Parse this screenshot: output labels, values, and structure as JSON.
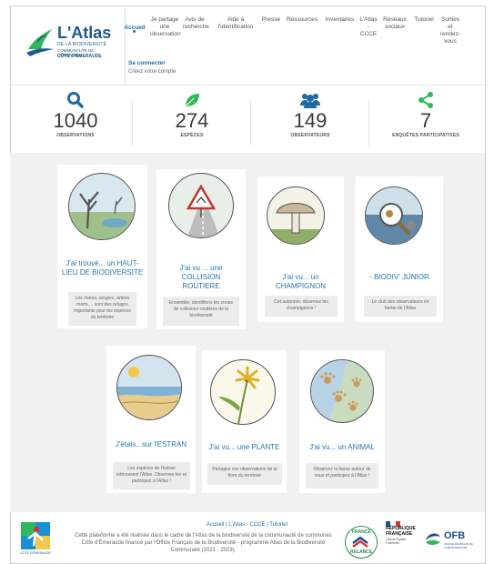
{
  "brand": {
    "title": "L'Atlas",
    "line1": "DE LA BIODIVERSITÉ",
    "line2": "COMMUNAUTÉ DE COMMUNES",
    "line3": "CÔTE D'ÉMERAUDE"
  },
  "nav": {
    "items": [
      {
        "label": "Accueil"
      },
      {
        "label": "Je partage une observation"
      },
      {
        "label": "Avis de recherche"
      },
      {
        "label": "Aide à l'identification"
      },
      {
        "label": "Presse"
      },
      {
        "label": "Ressources"
      },
      {
        "label": "Inventaires"
      },
      {
        "label": "L'Atlas - CCCE"
      },
      {
        "label": "Réseaux sociaux"
      },
      {
        "label": "Tutoriel"
      },
      {
        "label": "Sorties et rendez-vous"
      }
    ]
  },
  "account": {
    "login": "Se connecter",
    "create": "Créez votre compte"
  },
  "stats": [
    {
      "value": "1040",
      "label": "OBSERVATIONS",
      "icon": "search-icon"
    },
    {
      "value": "274",
      "label": "ESPÈCES",
      "icon": "leaf-icon"
    },
    {
      "value": "149",
      "label": "OBSERVATEURS",
      "icon": "users-icon"
    },
    {
      "value": "7",
      "label": "ENQUÊTES PARTICIPATIVES",
      "icon": "share-icon"
    }
  ],
  "cards": [
    {
      "title": "J'ai trouvé... un HAUT-LIEU DE BIODIVERSITE",
      "desc": "Les mares, vergers, arbres morts ... sont des refuges importants pour les espèces du territoire"
    },
    {
      "title": "J'ai vu ... une COLLISION ROUTIERE",
      "desc": "Ensemble, identifions les zones de collisions routières de la biodiversité"
    },
    {
      "title": "J'ai vu... un CHAMPIGNON",
      "desc": "Cet automne, observez les champignons !"
    },
    {
      "title": "- BIODIV' JUNIOR",
      "desc": "Le club des observateurs en herbe de l'Atlas"
    },
    {
      "title": "J'étais...sur l'ESTRAN",
      "desc": "Les espèces de l'estran intéressent l'Atlas. Observez-les et participez à l'Atlas !"
    },
    {
      "title": "J'ai vu... une PLANTE",
      "desc": "Partagez vos observations de la flore du territoire"
    },
    {
      "title": "J'ai vu... un ANIMAL",
      "desc": "Observez la faune autour de vous et participez à l'Atlas !"
    }
  ],
  "footer": {
    "links": "Accueil | L'Atlas - CCCE | Tutoriel",
    "text": "Cette plateforme a été réalisée dans le cadre de l'Atlas de la biodiversité de la communauté de communes Côte d'Émeraude financé par l'Office Français de la Biodiversité - programme Atlas de la Biodiversité Communale (2021 - 2023).",
    "cc_caption": "CÔTE D'ÉMERAUDE",
    "relance_top": "FRANCE",
    "relance_bottom": "RELANCE",
    "rf_title": "RÉPUBLIQUE FRANÇAISE",
    "rf_motto": "Liberté Égalité Fraternité",
    "ofb": "OFB",
    "ofb_sub": "OFFICE FRANÇAIS DE LA BIODIVERSITÉ"
  },
  "colors": {
    "accent": "#1f77b4",
    "brand_green": "#2fb85a",
    "stat_blue": "#1f6aa5"
  }
}
